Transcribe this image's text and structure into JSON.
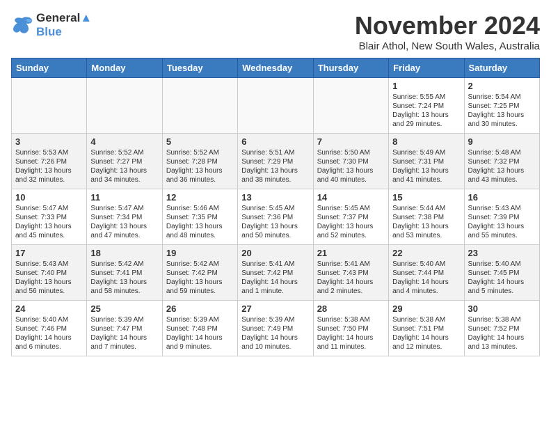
{
  "logo": {
    "line1": "General",
    "line2": "Blue"
  },
  "title": "November 2024",
  "location": "Blair Athol, New South Wales, Australia",
  "days_of_week": [
    "Sunday",
    "Monday",
    "Tuesday",
    "Wednesday",
    "Thursday",
    "Friday",
    "Saturday"
  ],
  "weeks": [
    [
      {
        "day": "",
        "content": ""
      },
      {
        "day": "",
        "content": ""
      },
      {
        "day": "",
        "content": ""
      },
      {
        "day": "",
        "content": ""
      },
      {
        "day": "",
        "content": ""
      },
      {
        "day": "1",
        "content": "Sunrise: 5:55 AM\nSunset: 7:24 PM\nDaylight: 13 hours and 29 minutes."
      },
      {
        "day": "2",
        "content": "Sunrise: 5:54 AM\nSunset: 7:25 PM\nDaylight: 13 hours and 30 minutes."
      }
    ],
    [
      {
        "day": "3",
        "content": "Sunrise: 5:53 AM\nSunset: 7:26 PM\nDaylight: 13 hours and 32 minutes."
      },
      {
        "day": "4",
        "content": "Sunrise: 5:52 AM\nSunset: 7:27 PM\nDaylight: 13 hours and 34 minutes."
      },
      {
        "day": "5",
        "content": "Sunrise: 5:52 AM\nSunset: 7:28 PM\nDaylight: 13 hours and 36 minutes."
      },
      {
        "day": "6",
        "content": "Sunrise: 5:51 AM\nSunset: 7:29 PM\nDaylight: 13 hours and 38 minutes."
      },
      {
        "day": "7",
        "content": "Sunrise: 5:50 AM\nSunset: 7:30 PM\nDaylight: 13 hours and 40 minutes."
      },
      {
        "day": "8",
        "content": "Sunrise: 5:49 AM\nSunset: 7:31 PM\nDaylight: 13 hours and 41 minutes."
      },
      {
        "day": "9",
        "content": "Sunrise: 5:48 AM\nSunset: 7:32 PM\nDaylight: 13 hours and 43 minutes."
      }
    ],
    [
      {
        "day": "10",
        "content": "Sunrise: 5:47 AM\nSunset: 7:33 PM\nDaylight: 13 hours and 45 minutes."
      },
      {
        "day": "11",
        "content": "Sunrise: 5:47 AM\nSunset: 7:34 PM\nDaylight: 13 hours and 47 minutes."
      },
      {
        "day": "12",
        "content": "Sunrise: 5:46 AM\nSunset: 7:35 PM\nDaylight: 13 hours and 48 minutes."
      },
      {
        "day": "13",
        "content": "Sunrise: 5:45 AM\nSunset: 7:36 PM\nDaylight: 13 hours and 50 minutes."
      },
      {
        "day": "14",
        "content": "Sunrise: 5:45 AM\nSunset: 7:37 PM\nDaylight: 13 hours and 52 minutes."
      },
      {
        "day": "15",
        "content": "Sunrise: 5:44 AM\nSunset: 7:38 PM\nDaylight: 13 hours and 53 minutes."
      },
      {
        "day": "16",
        "content": "Sunrise: 5:43 AM\nSunset: 7:39 PM\nDaylight: 13 hours and 55 minutes."
      }
    ],
    [
      {
        "day": "17",
        "content": "Sunrise: 5:43 AM\nSunset: 7:40 PM\nDaylight: 13 hours and 56 minutes."
      },
      {
        "day": "18",
        "content": "Sunrise: 5:42 AM\nSunset: 7:41 PM\nDaylight: 13 hours and 58 minutes."
      },
      {
        "day": "19",
        "content": "Sunrise: 5:42 AM\nSunset: 7:42 PM\nDaylight: 13 hours and 59 minutes."
      },
      {
        "day": "20",
        "content": "Sunrise: 5:41 AM\nSunset: 7:42 PM\nDaylight: 14 hours and 1 minute."
      },
      {
        "day": "21",
        "content": "Sunrise: 5:41 AM\nSunset: 7:43 PM\nDaylight: 14 hours and 2 minutes."
      },
      {
        "day": "22",
        "content": "Sunrise: 5:40 AM\nSunset: 7:44 PM\nDaylight: 14 hours and 4 minutes."
      },
      {
        "day": "23",
        "content": "Sunrise: 5:40 AM\nSunset: 7:45 PM\nDaylight: 14 hours and 5 minutes."
      }
    ],
    [
      {
        "day": "24",
        "content": "Sunrise: 5:40 AM\nSunset: 7:46 PM\nDaylight: 14 hours and 6 minutes."
      },
      {
        "day": "25",
        "content": "Sunrise: 5:39 AM\nSunset: 7:47 PM\nDaylight: 14 hours and 7 minutes."
      },
      {
        "day": "26",
        "content": "Sunrise: 5:39 AM\nSunset: 7:48 PM\nDaylight: 14 hours and 9 minutes."
      },
      {
        "day": "27",
        "content": "Sunrise: 5:39 AM\nSunset: 7:49 PM\nDaylight: 14 hours and 10 minutes."
      },
      {
        "day": "28",
        "content": "Sunrise: 5:38 AM\nSunset: 7:50 PM\nDaylight: 14 hours and 11 minutes."
      },
      {
        "day": "29",
        "content": "Sunrise: 5:38 AM\nSunset: 7:51 PM\nDaylight: 14 hours and 12 minutes."
      },
      {
        "day": "30",
        "content": "Sunrise: 5:38 AM\nSunset: 7:52 PM\nDaylight: 14 hours and 13 minutes."
      }
    ]
  ]
}
